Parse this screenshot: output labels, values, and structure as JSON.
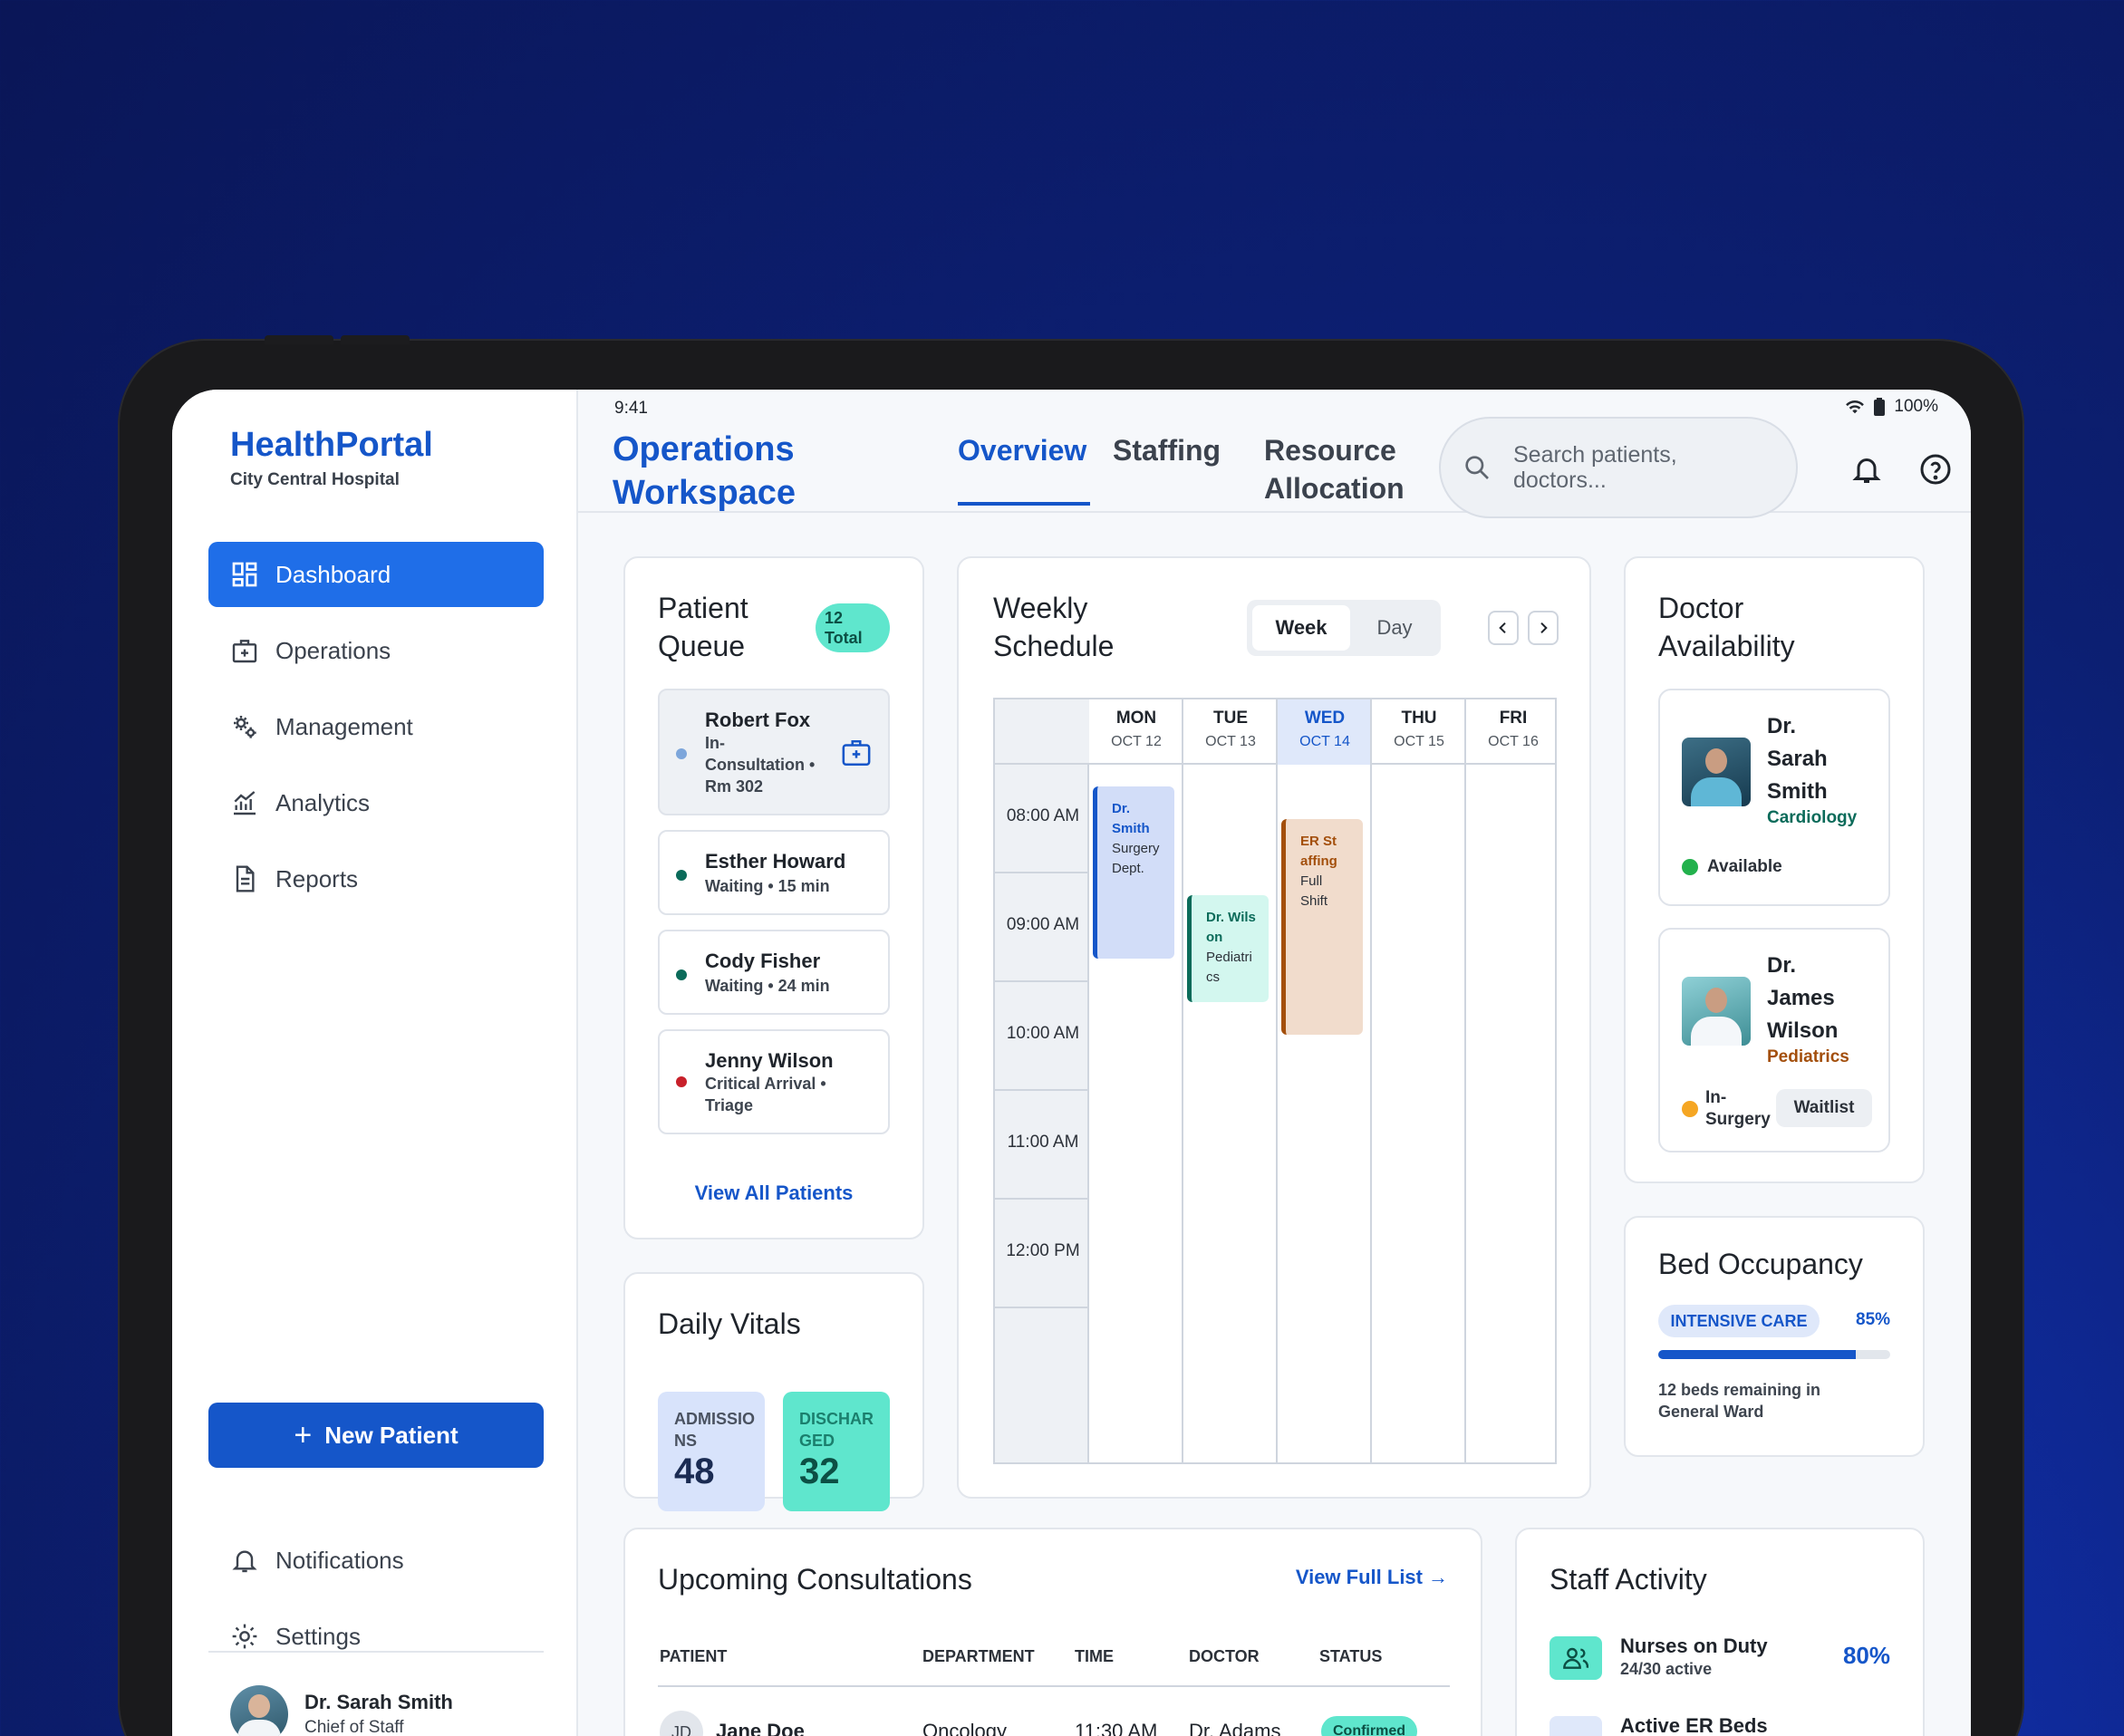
{
  "status_bar": {
    "time": "9:41",
    "battery": "100%"
  },
  "brand": {
    "name": "HealthPortal",
    "subtitle": "City Central Hospital"
  },
  "sidebar": {
    "items": [
      {
        "label": "Dashboard",
        "icon": "dashboard-icon",
        "active": true
      },
      {
        "label": "Operations",
        "icon": "medical-bag-icon"
      },
      {
        "label": "Management",
        "icon": "gears-icon"
      },
      {
        "label": "Analytics",
        "icon": "chart-icon"
      },
      {
        "label": "Reports",
        "icon": "document-icon"
      }
    ],
    "new_patient_label": "New Patient",
    "bottom_items": [
      {
        "label": "Notifications",
        "icon": "bell-icon"
      },
      {
        "label": "Settings",
        "icon": "gear-icon"
      }
    ],
    "profile": {
      "name": "Dr. Sarah Smith",
      "role": "Chief of Staff"
    }
  },
  "header": {
    "title": "Operations Workspace",
    "tabs": [
      {
        "label": "Overview",
        "active": true
      },
      {
        "label": "Staffing"
      },
      {
        "label": "Resource Allocation"
      }
    ],
    "search_placeholder": "Search patients, doctors..."
  },
  "patient_queue": {
    "title": "Patient Queue",
    "badge": "12 Total",
    "items": [
      {
        "name": "Robert Fox",
        "status": "In-Consultation • Rm 302",
        "dot_color": "#7da6db"
      },
      {
        "name": "Esther Howard",
        "status": "Waiting • 15 min",
        "dot_color": "#0b6b5a"
      },
      {
        "name": "Cody Fisher",
        "status": "Waiting • 24 min",
        "dot_color": "#0b6b5a"
      },
      {
        "name": "Jenny Wilson",
        "status": "Critical Arrival • Triage",
        "dot_color": "#c8202a"
      }
    ],
    "view_all": "View All Patients"
  },
  "daily_vitals": {
    "title": "Daily Vitals",
    "admissions": {
      "label": "ADMISSIONS",
      "value": "48"
    },
    "discharged": {
      "label": "DISCHARGED",
      "value": "32"
    }
  },
  "weekly_schedule": {
    "title": "Weekly Schedule",
    "toggle": {
      "week": "Week",
      "day": "Day",
      "selected": "Week"
    },
    "days": [
      {
        "name": "MON",
        "date": "OCT 12"
      },
      {
        "name": "TUE",
        "date": "OCT 13"
      },
      {
        "name": "WED",
        "date": "OCT 14",
        "today": true
      },
      {
        "name": "THU",
        "date": "OCT 15"
      },
      {
        "name": "FRI",
        "date": "OCT 16"
      }
    ],
    "times": [
      "08:00 AM",
      "09:00 AM",
      "10:00 AM",
      "11:00 AM",
      "12:00 PM"
    ],
    "events": [
      {
        "title": "Dr. Smith",
        "detail": "Surgery Dept.",
        "day": "MON"
      },
      {
        "title": "Dr. Wilson",
        "detail": "Pediatrics",
        "day": "TUE"
      },
      {
        "title": "ER Staffing",
        "detail": "Full Shift",
        "day": "WED"
      }
    ]
  },
  "doctor_availability": {
    "title": "Doctor Availability",
    "doctors": [
      {
        "name": "Dr. Sarah Smith",
        "specialty": "Cardiology",
        "status": "Available"
      },
      {
        "name": "Dr. James Wilson",
        "specialty": "Pediatrics",
        "status": "In-Surgery",
        "action": "Waitlist"
      }
    ]
  },
  "bed_occupancy": {
    "title": "Bed Occupancy",
    "unit": "INTENSIVE CARE",
    "percent_label": "85%",
    "fill_fraction": 0.85,
    "note": "12 beds remaining in General Ward"
  },
  "consultations": {
    "title": "Upcoming Consultations",
    "view_full": "View Full List",
    "columns": [
      "PATIENT",
      "DEPARTMENT",
      "TIME",
      "DOCTOR",
      "STATUS"
    ],
    "rows": [
      {
        "initials": "JD",
        "patient": "Jane Doe",
        "department": "Oncology",
        "time": "11:30 AM",
        "doctor": "Dr. Adams",
        "status": "Confirmed"
      }
    ]
  },
  "staff_activity": {
    "title": "Staff Activity",
    "items": [
      {
        "label": "Nurses on Duty",
        "sub": "24/30 active",
        "value": "80%"
      },
      {
        "label": "Active ER Beds",
        "sub": "",
        "value": ""
      }
    ]
  },
  "colors": {
    "primary": "#1556c9",
    "accent_teal": "#5fe6cd",
    "danger": "#c8202a"
  }
}
